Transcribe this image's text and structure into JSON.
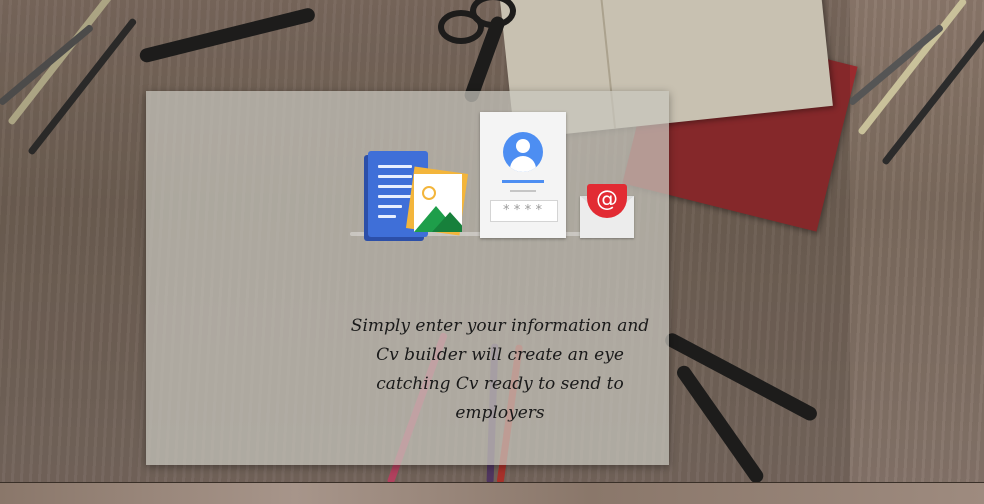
{
  "caption": "Simply enter your information and Cv builder will create an eye catching Cv ready to send to employers",
  "illustration": {
    "icons": [
      "document-icon",
      "photo-icon",
      "login-card-icon",
      "email-icon"
    ],
    "password_mask": "****",
    "email_symbol": "@"
  },
  "colors": {
    "document_blue": "#3f6fd8",
    "photo_yellow": "#f3b53b",
    "avatar_blue": "#4d8ef2",
    "email_red": "#e22b33",
    "paper": "#c8c6be"
  }
}
